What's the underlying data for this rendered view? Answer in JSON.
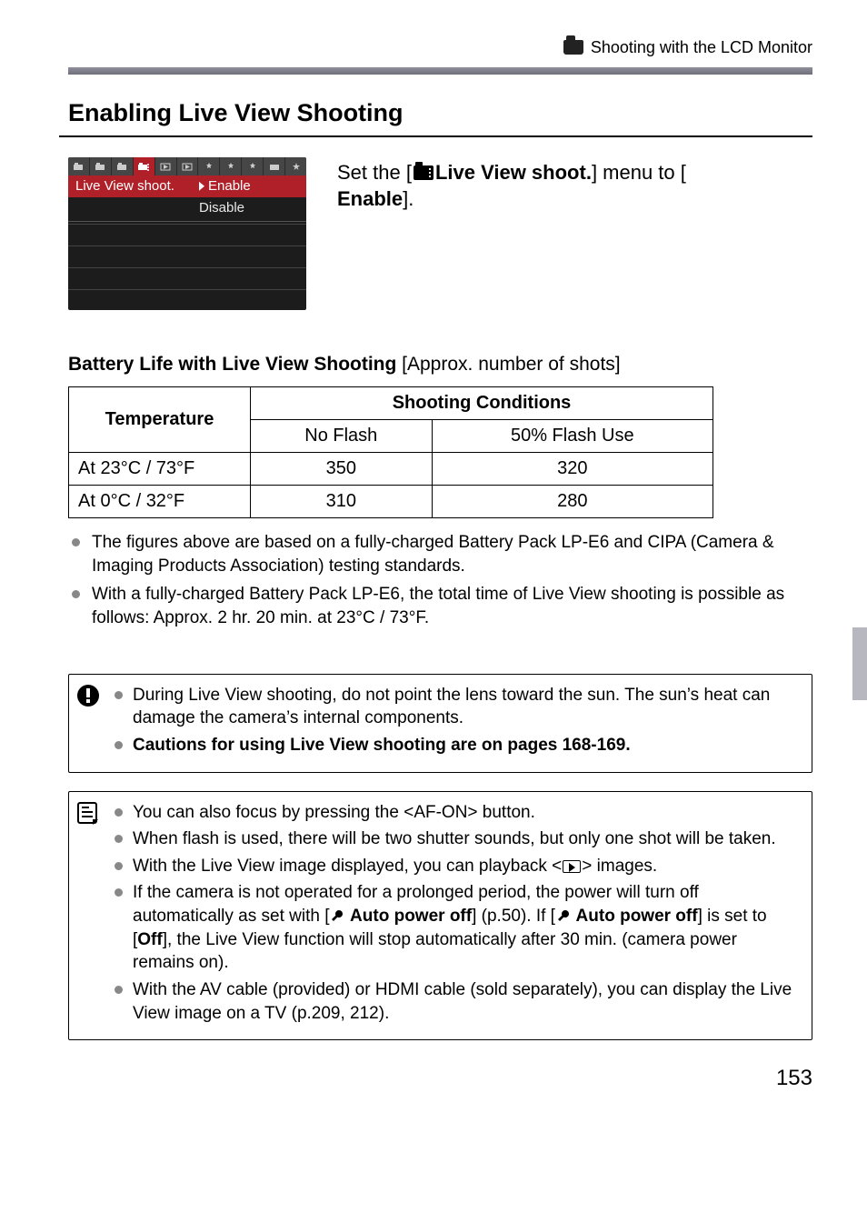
{
  "header": {
    "breadcrumb": "Shooting with the LCD Monitor"
  },
  "section": {
    "title": "Enabling Live View Shooting"
  },
  "menu": {
    "label": "Live View shoot.",
    "opt_enable": "Enable",
    "opt_disable": "Disable"
  },
  "instruction": {
    "pre": "Set the [",
    "opt": " Live View shoot.",
    "mid": "] menu to [",
    "enable": "Enable",
    "post": "]."
  },
  "battery": {
    "heading_bold": "Battery Life with Live View Shooting",
    "heading_thin": " [Approx. number of shots]",
    "th_temp": "Temperature",
    "th_cond": "Shooting Conditions",
    "th_noflash": "No Flash",
    "th_flash50": "50% Flash Use",
    "rows": [
      {
        "temp": "At 23°C / 73°F",
        "noflash": "350",
        "flash50": "320"
      },
      {
        "temp": "At 0°C / 32°F",
        "noflash": "310",
        "flash50": "280"
      }
    ]
  },
  "notes_after_table": [
    "The figures above are based on a fully-charged Battery Pack LP-E6 and CIPA (Camera & Imaging Products Association) testing standards.",
    "With a fully-charged Battery Pack LP-E6, the total time of Live View shooting is possible as follows: Approx. 2 hr. 20 min. at 23°C / 73°F."
  ],
  "warning_box": [
    "During Live View shooting, do not point the lens toward the sun. The sun’s heat can damage the camera’s internal components.",
    "Cautions for using Live View shooting are on pages 168-169."
  ],
  "tips_box": {
    "t0_pre": "You can also focus by pressing the <",
    "t0_af": "AF-ON",
    "t0_post": "> button.",
    "t1": "When flash is used, there will be two shutter sounds, but only one shot will be taken.",
    "t2_pre": "With the Live View image displayed, you can playback <",
    "t2_post": "> images.",
    "t3_pre": "If the camera is not operated for a prolonged period, the power will turn off automatically as set with [",
    "t3_apo": " Auto power off",
    "t3_mid": "] (p.50). If [",
    "t3_apo2": " Auto power off",
    "t3_mid2": "] is set to [",
    "t3_off": "Off",
    "t3_post": "], the Live View function will stop automatically after 30 min. (camera power remains on).",
    "t4": "With the AV cable (provided) or HDMI cable (sold separately), you can display the Live View image on a TV (p.209, 212)."
  },
  "page_number": "153"
}
